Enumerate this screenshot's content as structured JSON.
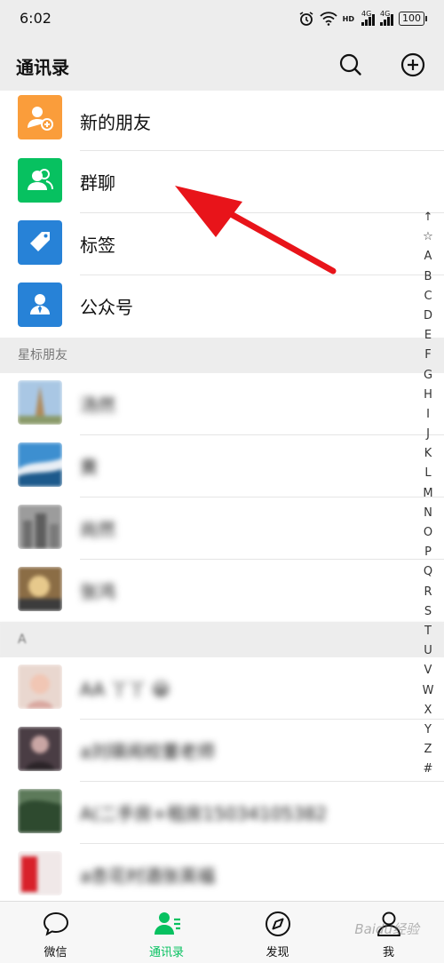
{
  "status": {
    "time": "6:02",
    "net1": "4G",
    "net2": "4G",
    "hd": "HD",
    "battery": "100"
  },
  "header": {
    "title": "通讯录"
  },
  "menu": [
    {
      "label": "新的朋友",
      "color": "#fa9d3b",
      "icon": "add-friend-icon"
    },
    {
      "label": "群聊",
      "color": "#07c160",
      "icon": "group-chat-icon"
    },
    {
      "label": "标签",
      "color": "#2782d7",
      "icon": "tag-icon"
    },
    {
      "label": "公众号",
      "color": "#2782d7",
      "icon": "official-account-icon"
    }
  ],
  "starred": {
    "header": "星标朋友",
    "contacts": [
      {
        "name": "汤然"
      },
      {
        "name": "黄"
      },
      {
        "name": "尚然"
      },
      {
        "name": "张鸿"
      }
    ]
  },
  "section_a": {
    "header": "A",
    "contacts": [
      {
        "name": "AA 丫丫 😀"
      },
      {
        "name": "a刘瑛闹校董老师"
      },
      {
        "name": "A(二手房+租房15034105382"
      },
      {
        "name": "a杏花村酒张英福"
      }
    ]
  },
  "index": [
    "↑",
    "☆",
    "A",
    "B",
    "C",
    "D",
    "E",
    "F",
    "G",
    "H",
    "I",
    "J",
    "K",
    "L",
    "M",
    "N",
    "O",
    "P",
    "Q",
    "R",
    "S",
    "T",
    "U",
    "V",
    "W",
    "X",
    "Y",
    "Z",
    "#"
  ],
  "tabs": [
    {
      "label": "微信",
      "icon": "chat-bubble-icon"
    },
    {
      "label": "通讯录",
      "icon": "contacts-icon",
      "active": true
    },
    {
      "label": "发现",
      "icon": "compass-icon"
    },
    {
      "label": "我",
      "icon": "person-icon"
    }
  ],
  "watermark": "Baidu经验",
  "colors": {
    "accent": "#07c160",
    "arrow": "#e8141a"
  }
}
